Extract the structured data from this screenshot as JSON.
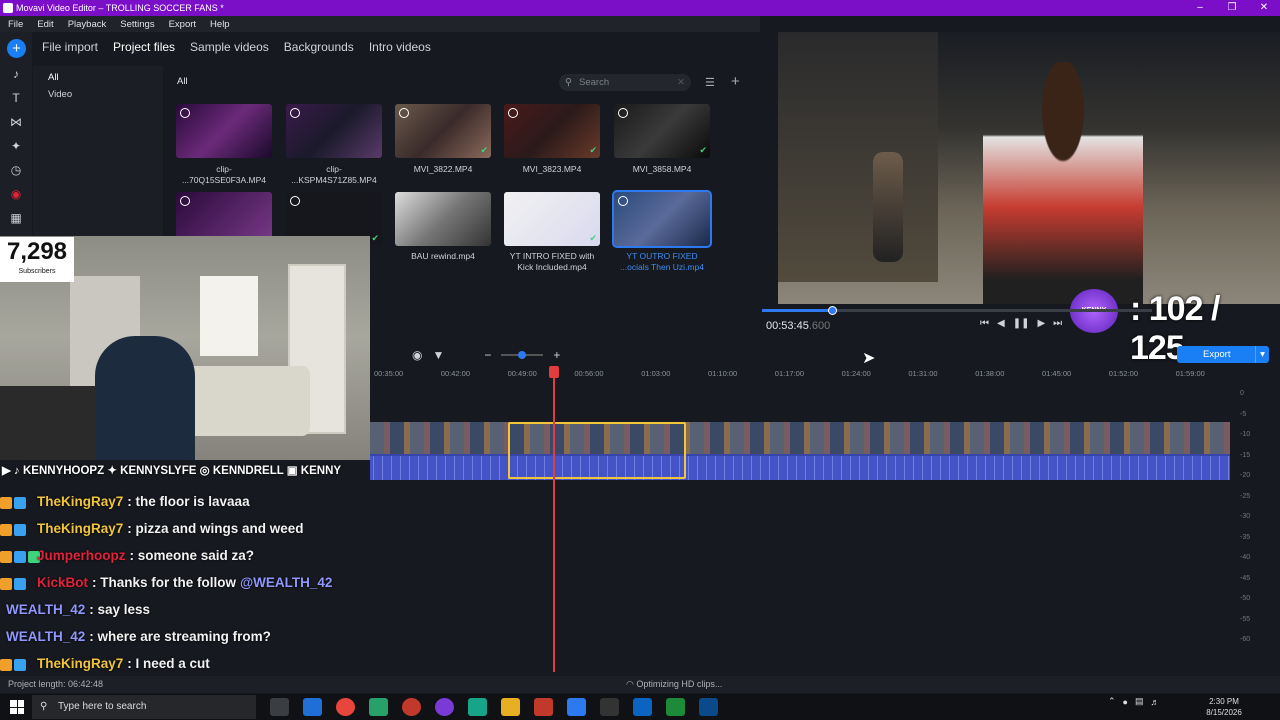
{
  "window": {
    "title": "Movavi Video Editor – TROLLING SOCCER FANS *"
  },
  "menu": [
    "File",
    "Edit",
    "Playback",
    "Settings",
    "Export",
    "Help"
  ],
  "import_tabs": [
    "File import",
    "Project files",
    "Sample videos",
    "Backgrounds",
    "Intro videos"
  ],
  "categories": [
    "All",
    "Video"
  ],
  "library": {
    "header": "All",
    "search_placeholder": "Search",
    "items": [
      {
        "caption1": "clip-",
        "caption2": "...70Q15SE0F3A.MP4"
      },
      {
        "caption1": "clip-",
        "caption2": "...KSPM4S71Z85.MP4"
      },
      {
        "caption1": "MVI_3822.MP4",
        "caption2": ""
      },
      {
        "caption1": "MVI_3823.MP4",
        "caption2": ""
      },
      {
        "caption1": "MVI_3858.MP4",
        "caption2": ""
      },
      {
        "caption1": "BAU rewind.mp4",
        "caption2": ""
      },
      {
        "caption1": "YT INTRO FIXED with",
        "caption2": "Kick Included.mp4"
      },
      {
        "caption1": "YT OUTRO FIXED",
        "caption2": "...ocials Then Uzi.mp4"
      }
    ]
  },
  "player": {
    "timecode": "00:53:45",
    "timecode_ms": ".600",
    "progress": 0.18,
    "aspect": "16:9"
  },
  "overlay": {
    "subs_count": "7,298",
    "subs_label": "Subscribers",
    "goal": ": 102 / 125",
    "logo": "KENNY",
    "socials": "▶ ♪ KENNYHOOPZ ✦ KENNYSLYFE ◎ KENNDRELL ▣ KENNY"
  },
  "chat": [
    {
      "user": "TheKingRay7",
      "user_color": "#f0c53a",
      "text": ": the floor is lavaaa",
      "badges": 2,
      "mention": ""
    },
    {
      "user": "TheKingRay7",
      "user_color": "#f0c53a",
      "text": ": pizza and wings and weed",
      "badges": 2,
      "mention": ""
    },
    {
      "user": "Jumperhoopz",
      "user_color": "#e0223a",
      "text": ": someone said za?",
      "badges": 3,
      "mention": ""
    },
    {
      "user": "KickBot",
      "user_color": "#e0223a",
      "text": ": Thanks for the follow",
      "badges": 2,
      "mention": "@WEALTH_42"
    },
    {
      "user": "WEALTH_42",
      "user_color": "#8f97ff",
      "text": ": say less",
      "badges": 0,
      "mention": ""
    },
    {
      "user": "WEALTH_42",
      "user_color": "#8f97ff",
      "text": ": where are streaming from?",
      "badges": 0,
      "mention": ""
    },
    {
      "user": "TheKingRay7",
      "user_color": "#f0c53a",
      "text": ": I need a cut",
      "badges": 2,
      "mention": ""
    }
  ],
  "timeline": {
    "ruler": [
      "00:35:00",
      "00:42:00",
      "00:49:00",
      "00:56:00",
      "01:03:00",
      "01:10:00",
      "01:17:00",
      "01:24:00",
      "01:31:00",
      "01:38:00",
      "01:45:00",
      "01:52:00",
      "01:59:00"
    ],
    "db_scale": [
      "0",
      "-5",
      "-10",
      "-15",
      "-20",
      "-25",
      "-30",
      "-35",
      "-40",
      "-45",
      "-50",
      "-55",
      "-60"
    ]
  },
  "export_label": "Export",
  "status": {
    "project_length": "Project length: 06:42:48",
    "optimizing": "Optimizing HD clips..."
  },
  "taskbar": {
    "search_placeholder": "Type here to search",
    "time": "2:30 PM",
    "date": "8/15/2026"
  }
}
